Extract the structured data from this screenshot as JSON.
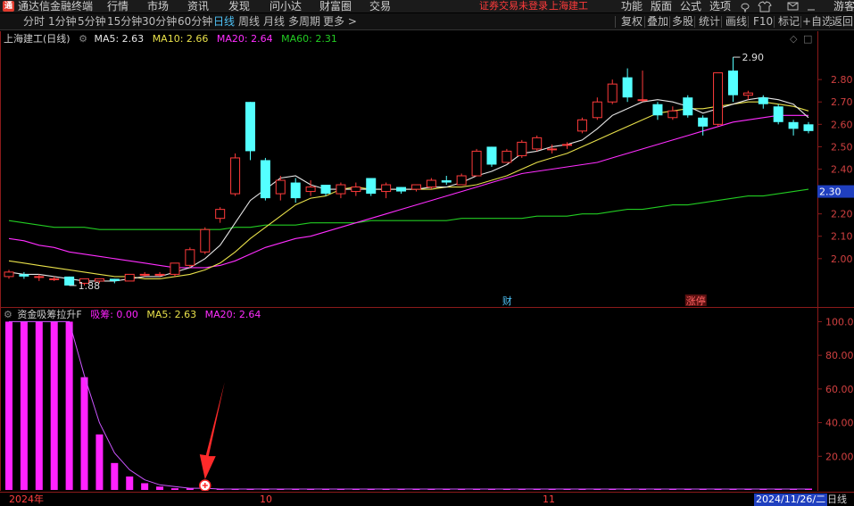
{
  "app": {
    "title": "通达信金融终端",
    "menu": [
      "行情",
      "市场",
      "资讯",
      "发现",
      "问小达",
      "财富圈",
      "交易"
    ],
    "login_status": "证券交易未登录",
    "stock_name": "上海建工",
    "right_menu": [
      "功能",
      "版面",
      "公式",
      "选项"
    ],
    "user": "游客"
  },
  "toolbar": {
    "periods": [
      "分时",
      "1分钟",
      "5分钟",
      "15分钟",
      "30分钟",
      "60分钟",
      "日线",
      "周线",
      "月线",
      "多周期",
      "更多 >"
    ],
    "active_period": "日线",
    "right_tools": [
      "复权",
      "叠加",
      "多股",
      "统计",
      "画线",
      "F10",
      "标记",
      "+自选",
      "返回"
    ]
  },
  "kline_legend": {
    "title": "上海建工(日线)",
    "ma5": "MA5: 2.63",
    "ma10": "MA10: 2.66",
    "ma20": "MA20: 2.64",
    "ma60": "MA60: 2.31"
  },
  "colors": {
    "up": "#ff3b3b",
    "down": "#54ffff",
    "ma5": "#e6e6e6",
    "ma10": "#e8e04a",
    "ma20": "#ff2dff",
    "ma60": "#22cc22",
    "bar": "#ff22ff",
    "axis": "#8b1a1a"
  },
  "kline_axis": {
    "labels": [
      "2.80",
      "2.70",
      "2.60",
      "2.50",
      "2.40",
      "2.30",
      "2.20",
      "2.10",
      "2.00"
    ],
    "current_price": "2.30"
  },
  "annotations": {
    "high": "2.90",
    "low": "1.88",
    "event1": "财",
    "event2": "涨停"
  },
  "indicator_legend": {
    "title": "资金吸筹拉升F",
    "xichou": "吸筹: 0.00",
    "ma5": "MA5: 2.63",
    "ma20": "MA20: 2.64"
  },
  "indicator_axis": {
    "labels": [
      "100.00",
      "80.00",
      "60.00",
      "40.00",
      "20.00"
    ]
  },
  "bottom": {
    "year": "2024年",
    "month1": "10",
    "month2": "11",
    "date": "2024/11/26/二",
    "period": "日线"
  },
  "chart_data": [
    {
      "type": "candlestick",
      "title": "上海建工(日线)",
      "candles": [
        {
          "o": 1.92,
          "c": 1.94,
          "h": 1.95,
          "l": 1.91
        },
        {
          "o": 1.93,
          "c": 1.92,
          "h": 1.94,
          "l": 1.91
        },
        {
          "o": 1.92,
          "c": 1.92,
          "h": 1.93,
          "l": 1.9
        },
        {
          "o": 1.91,
          "c": 1.91,
          "h": 1.92,
          "l": 1.9
        },
        {
          "o": 1.92,
          "c": 1.88,
          "h": 1.92,
          "l": 1.88
        },
        {
          "o": 1.89,
          "c": 1.91,
          "h": 1.91,
          "l": 1.88
        },
        {
          "o": 1.9,
          "c": 1.91,
          "h": 1.91,
          "l": 1.89
        },
        {
          "o": 1.91,
          "c": 1.9,
          "h": 1.91,
          "l": 1.89
        },
        {
          "o": 1.9,
          "c": 1.93,
          "h": 1.93,
          "l": 1.9
        },
        {
          "o": 1.93,
          "c": 1.93,
          "h": 1.94,
          "l": 1.92
        },
        {
          "o": 1.93,
          "c": 1.93,
          "h": 1.94,
          "l": 1.92
        },
        {
          "o": 1.93,
          "c": 1.98,
          "h": 1.98,
          "l": 1.92
        },
        {
          "o": 1.97,
          "c": 2.04,
          "h": 2.05,
          "l": 1.96
        },
        {
          "o": 2.03,
          "c": 2.13,
          "h": 2.14,
          "l": 2.02
        },
        {
          "o": 2.18,
          "c": 2.22,
          "h": 2.23,
          "l": 2.16
        },
        {
          "o": 2.29,
          "c": 2.45,
          "h": 2.47,
          "l": 2.28
        },
        {
          "o": 2.7,
          "c": 2.48,
          "h": 2.7,
          "l": 2.44
        },
        {
          "o": 2.44,
          "c": 2.27,
          "h": 2.45,
          "l": 2.26
        },
        {
          "o": 2.29,
          "c": 2.35,
          "h": 2.37,
          "l": 2.26
        },
        {
          "o": 2.34,
          "c": 2.27,
          "h": 2.36,
          "l": 2.25
        },
        {
          "o": 2.3,
          "c": 2.32,
          "h": 2.35,
          "l": 2.28
        },
        {
          "o": 2.33,
          "c": 2.29,
          "h": 2.33,
          "l": 2.28
        },
        {
          "o": 2.29,
          "c": 2.33,
          "h": 2.34,
          "l": 2.27
        },
        {
          "o": 2.3,
          "c": 2.32,
          "h": 2.34,
          "l": 2.28
        },
        {
          "o": 2.36,
          "c": 2.29,
          "h": 2.36,
          "l": 2.28
        },
        {
          "o": 2.3,
          "c": 2.33,
          "h": 2.34,
          "l": 2.27
        },
        {
          "o": 2.32,
          "c": 2.3,
          "h": 2.32,
          "l": 2.29
        },
        {
          "o": 2.31,
          "c": 2.33,
          "h": 2.33,
          "l": 2.3
        },
        {
          "o": 2.32,
          "c": 2.35,
          "h": 2.36,
          "l": 2.31
        },
        {
          "o": 2.35,
          "c": 2.34,
          "h": 2.37,
          "l": 2.33
        },
        {
          "o": 2.33,
          "c": 2.37,
          "h": 2.38,
          "l": 2.33
        },
        {
          "o": 2.37,
          "c": 2.48,
          "h": 2.49,
          "l": 2.37
        },
        {
          "o": 2.5,
          "c": 2.42,
          "h": 2.5,
          "l": 2.41
        },
        {
          "o": 2.43,
          "c": 2.48,
          "h": 2.49,
          "l": 2.43
        },
        {
          "o": 2.46,
          "c": 2.52,
          "h": 2.53,
          "l": 2.45
        },
        {
          "o": 2.49,
          "c": 2.54,
          "h": 2.55,
          "l": 2.48
        },
        {
          "o": 2.49,
          "c": 2.49,
          "h": 2.51,
          "l": 2.47
        },
        {
          "o": 2.51,
          "c": 2.51,
          "h": 2.52,
          "l": 2.49
        },
        {
          "o": 2.57,
          "c": 2.62,
          "h": 2.63,
          "l": 2.56
        },
        {
          "o": 2.63,
          "c": 2.7,
          "h": 2.72,
          "l": 2.62
        },
        {
          "o": 2.7,
          "c": 2.78,
          "h": 2.8,
          "l": 2.69
        },
        {
          "o": 2.81,
          "c": 2.72,
          "h": 2.85,
          "l": 2.7
        },
        {
          "o": 2.71,
          "c": 2.71,
          "h": 2.84,
          "l": 2.7
        },
        {
          "o": 2.69,
          "c": 2.64,
          "h": 2.7,
          "l": 2.62
        },
        {
          "o": 2.63,
          "c": 2.66,
          "h": 2.68,
          "l": 2.62
        },
        {
          "o": 2.72,
          "c": 2.64,
          "h": 2.73,
          "l": 2.63
        },
        {
          "o": 2.63,
          "c": 2.59,
          "h": 2.64,
          "l": 2.55
        },
        {
          "o": 2.6,
          "c": 2.83,
          "h": 2.83,
          "l": 2.59
        },
        {
          "o": 2.84,
          "c": 2.73,
          "h": 2.9,
          "l": 2.7
        },
        {
          "o": 2.73,
          "c": 2.74,
          "h": 2.75,
          "l": 2.71
        },
        {
          "o": 2.72,
          "c": 2.69,
          "h": 2.73,
          "l": 2.67
        },
        {
          "o": 2.68,
          "c": 2.61,
          "h": 2.69,
          "l": 2.6
        },
        {
          "o": 2.61,
          "c": 2.58,
          "h": 2.62,
          "l": 2.55
        },
        {
          "o": 2.6,
          "c": 2.57,
          "h": 2.61,
          "l": 2.56
        }
      ],
      "ma5": [
        1.94,
        1.93,
        1.93,
        1.92,
        1.91,
        1.9,
        1.9,
        1.9,
        1.91,
        1.92,
        1.92,
        1.94,
        1.96,
        2.0,
        2.06,
        2.16,
        2.26,
        2.31,
        2.36,
        2.37,
        2.33,
        2.31,
        2.31,
        2.31,
        2.31,
        2.31,
        2.31,
        2.31,
        2.32,
        2.32,
        2.34,
        2.37,
        2.39,
        2.42,
        2.47,
        2.48,
        2.5,
        2.51,
        2.53,
        2.58,
        2.64,
        2.67,
        2.7,
        2.71,
        2.7,
        2.68,
        2.65,
        2.67,
        2.69,
        2.71,
        2.72,
        2.71,
        2.69,
        2.63
      ],
      "ma10": [
        1.99,
        1.98,
        1.97,
        1.96,
        1.95,
        1.94,
        1.93,
        1.92,
        1.92,
        1.91,
        1.91,
        1.92,
        1.93,
        1.95,
        1.98,
        2.03,
        2.09,
        2.14,
        2.19,
        2.24,
        2.27,
        2.28,
        2.31,
        2.32,
        2.31,
        2.31,
        2.31,
        2.31,
        2.31,
        2.32,
        2.32,
        2.33,
        2.35,
        2.37,
        2.4,
        2.43,
        2.45,
        2.47,
        2.5,
        2.53,
        2.56,
        2.59,
        2.62,
        2.65,
        2.66,
        2.67,
        2.67,
        2.68,
        2.69,
        2.7,
        2.7,
        2.69,
        2.68,
        2.66
      ],
      "ma20": [
        2.09,
        2.08,
        2.06,
        2.05,
        2.03,
        2.02,
        2.01,
        2.0,
        1.99,
        1.98,
        1.97,
        1.96,
        1.96,
        1.96,
        1.97,
        1.99,
        2.02,
        2.05,
        2.07,
        2.09,
        2.1,
        2.12,
        2.14,
        2.16,
        2.18,
        2.2,
        2.22,
        2.24,
        2.26,
        2.28,
        2.3,
        2.32,
        2.34,
        2.36,
        2.38,
        2.39,
        2.4,
        2.41,
        2.42,
        2.43,
        2.45,
        2.47,
        2.49,
        2.51,
        2.53,
        2.55,
        2.57,
        2.59,
        2.61,
        2.62,
        2.63,
        2.64,
        2.64,
        2.64
      ],
      "ma60": [
        2.17,
        2.16,
        2.15,
        2.14,
        2.14,
        2.14,
        2.13,
        2.13,
        2.13,
        2.13,
        2.13,
        2.13,
        2.13,
        2.13,
        2.13,
        2.14,
        2.14,
        2.15,
        2.15,
        2.15,
        2.16,
        2.16,
        2.16,
        2.16,
        2.17,
        2.17,
        2.17,
        2.17,
        2.17,
        2.17,
        2.18,
        2.18,
        2.18,
        2.18,
        2.18,
        2.19,
        2.19,
        2.19,
        2.2,
        2.2,
        2.21,
        2.22,
        2.22,
        2.23,
        2.24,
        2.24,
        2.25,
        2.26,
        2.27,
        2.28,
        2.28,
        2.29,
        2.3,
        2.31
      ],
      "ylim": [
        1.8,
        2.96
      ]
    },
    {
      "type": "bar",
      "title": "资金吸筹拉升F",
      "values": [
        100,
        100,
        100,
        100,
        100,
        67,
        33,
        16,
        8,
        4,
        2,
        1,
        1,
        1,
        0,
        0,
        0,
        0,
        0,
        0,
        0,
        0,
        0,
        0,
        0,
        0,
        0,
        0,
        0,
        0,
        0,
        0,
        0,
        0,
        0,
        0,
        0,
        0,
        0,
        0,
        0,
        0,
        0,
        0,
        0,
        0,
        0,
        0,
        0,
        0,
        0,
        0,
        0,
        0
      ],
      "line": [
        100,
        100,
        100,
        100,
        100,
        68,
        40,
        22,
        12,
        6,
        3,
        2,
        1,
        1,
        0,
        0,
        0,
        0,
        0,
        0,
        0,
        0,
        0,
        0,
        0,
        0,
        0,
        0,
        0,
        0,
        0,
        0,
        0,
        0,
        0,
        0,
        0,
        0,
        0,
        0,
        0,
        0,
        0,
        0,
        0,
        0,
        0,
        0,
        0,
        0,
        0,
        0,
        0,
        0
      ],
      "ylim": [
        0,
        105
      ]
    }
  ]
}
